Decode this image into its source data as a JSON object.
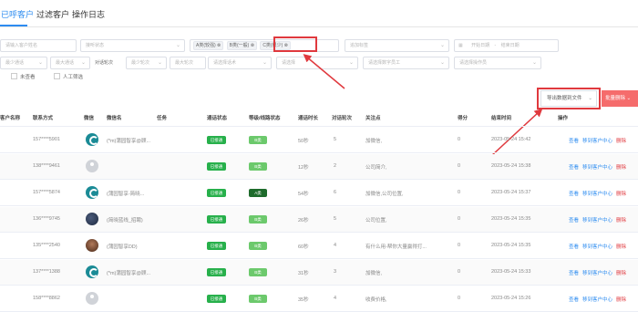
{
  "tabs": [
    {
      "label": "已呼客户",
      "active": true
    },
    {
      "label": "过滤客户",
      "active": false
    },
    {
      "label": "操作日志",
      "active": false
    }
  ],
  "filters": {
    "row1": {
      "name_placeholder": "请输入客户姓名",
      "connect_status": "接听状态",
      "tags": [
        "A类(较强)",
        "B类(一般)",
        "C类(很少)"
      ],
      "tag_more": "追加标签",
      "date_start": "开始日期",
      "date_sep": "-",
      "date_end": "结束日期"
    },
    "row2": {
      "min_talk": "最少通话",
      "max_talk": "最大通话",
      "talk_rounds_label": "对话轮次",
      "min_rounds": "最少轮次",
      "max_rounds": "最大轮次",
      "select_task": "请选择话术",
      "select_b": "请选择",
      "select_ai_service": "请选择数字员工",
      "select_manager": "请选择操作员"
    },
    "row3": {
      "unread_label": "未查看",
      "manual_label": "人工筛选"
    }
  },
  "actions": {
    "export_label": "导出数据到文件",
    "delete_label": "批量删除"
  },
  "table": {
    "headers": [
      "客户名称",
      "联系方式",
      "微信",
      "微信名",
      "任务",
      "通话状态",
      "等级/线路状态",
      "通话时长",
      "对话轮次",
      "关注点",
      "得分",
      "结束时间",
      "操作"
    ],
    "rows": [
      {
        "phone": "157****5901",
        "wx_type": "teal",
        "wx_name": "(*m)蒲园智享@顾...",
        "status": "已接通",
        "level": "B类",
        "level_style": "light",
        "duration": "50秒",
        "rounds": "5",
        "focus": "加微信,",
        "score": "0",
        "end_time": "2023-05-24 15:42"
      },
      {
        "phone": "138****9461",
        "wx_type": "grey",
        "wx_name": "",
        "status": "已接通",
        "level": "B类",
        "level_style": "light",
        "duration": "12秒",
        "rounds": "2",
        "focus": "公司简介,",
        "score": "0",
        "end_time": "2023-05-24 15:38"
      },
      {
        "phone": "157****5874",
        "wx_type": "teal",
        "wx_name": "(蒲园智享-简晓...",
        "status": "已接通",
        "level": "A类",
        "level_style": "dark",
        "duration": "54秒",
        "rounds": "6",
        "focus": "加微信,公司位置,",
        "score": "0",
        "end_time": "2023-05-24 15:37"
      },
      {
        "phone": "136****9745",
        "wx_type": "photo",
        "wx_name": "(简晓蓝线_招聘)",
        "status": "已接通",
        "level": "B类",
        "level_style": "light",
        "duration": "26秒",
        "rounds": "5",
        "focus": "公司位置,",
        "score": "0",
        "end_time": "2023-05-24 15:35"
      },
      {
        "phone": "135****2540",
        "wx_type": "photo2",
        "wx_name": "(蒲园智享DD)",
        "status": "已接通",
        "level": "B类",
        "level_style": "light",
        "duration": "60秒",
        "rounds": "4",
        "focus": "有什么用-帮你大量赢得打...",
        "score": "0",
        "end_time": "2023-05-24 15:35"
      },
      {
        "phone": "137****1388",
        "wx_type": "teal",
        "wx_name": "(*m)蒲园智享@顾...",
        "status": "已接通",
        "level": "B类",
        "level_style": "light",
        "duration": "31秒",
        "rounds": "3",
        "focus": "加微信,",
        "score": "0",
        "end_time": "2023-05-24 15:33"
      },
      {
        "phone": "158****8862",
        "wx_type": "grey",
        "wx_name": "",
        "status": "已接通",
        "level": "B类",
        "level_style": "light",
        "duration": "35秒",
        "rounds": "4",
        "focus": "收费价格,",
        "score": "0",
        "end_time": "2023-05-24 15:26"
      }
    ],
    "row_actions": {
      "view": "查看",
      "transfer": "移到客户中心",
      "delete": "删除"
    }
  },
  "colors": {
    "accent": "#2d8cf0",
    "danger": "#e0393e",
    "success": "#27b04b",
    "highlight_box": "#e0393e"
  }
}
